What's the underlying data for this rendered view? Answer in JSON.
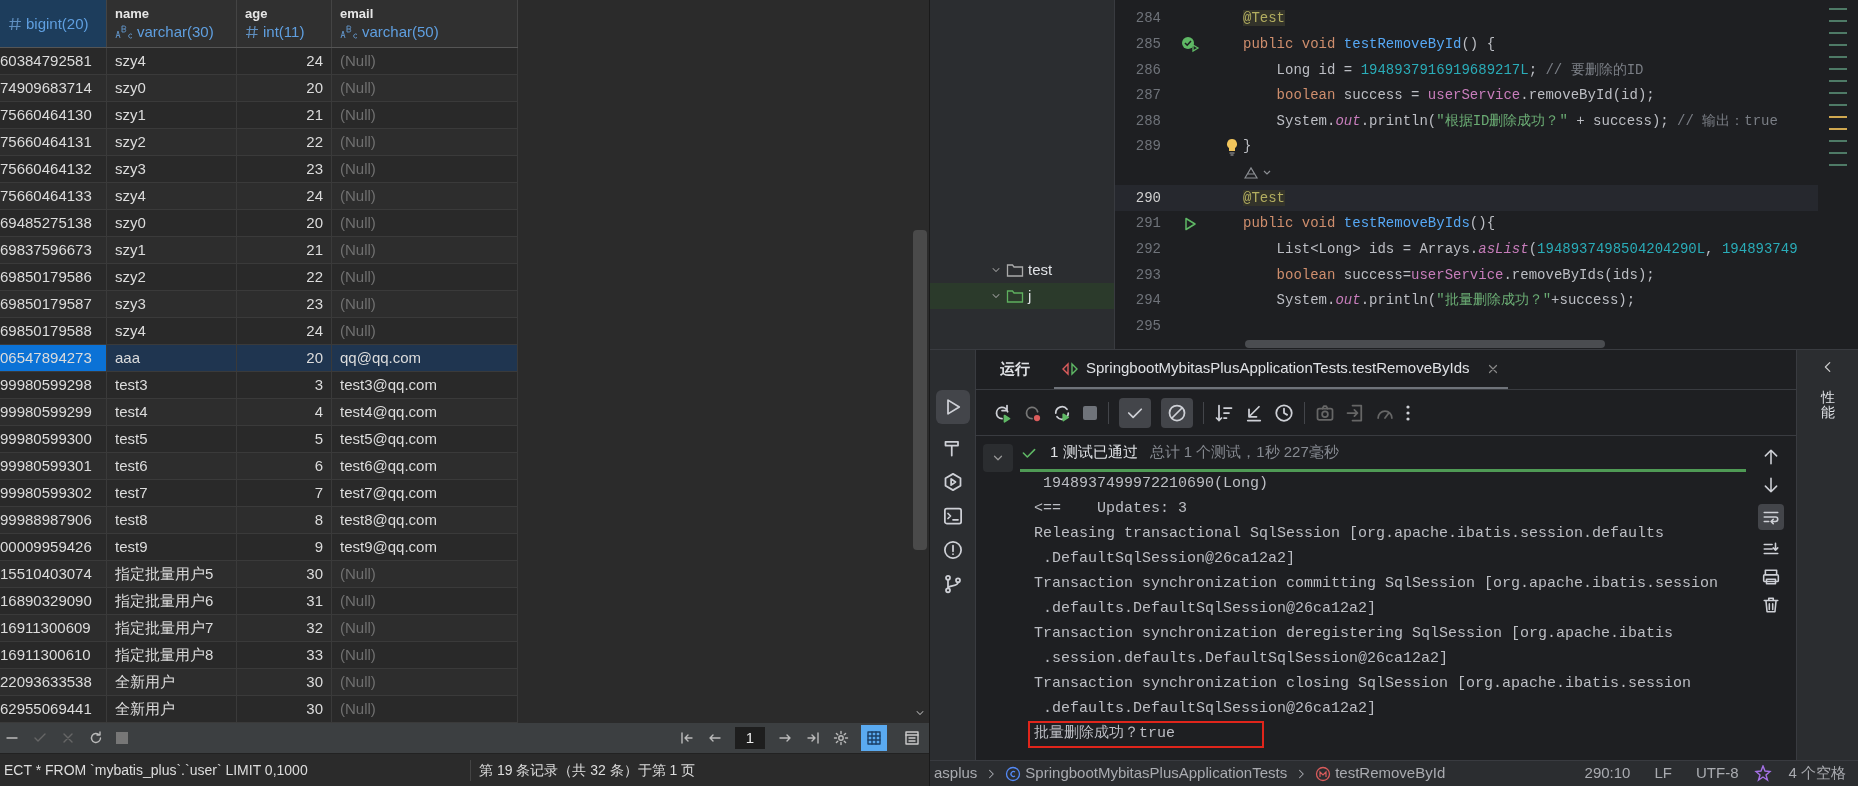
{
  "table": {
    "columns": [
      {
        "type": "bigint(20)",
        "kind": "number"
      },
      {
        "name": "name",
        "type": "varchar(30)",
        "kind": "text"
      },
      {
        "name": "age",
        "type": "int(11)",
        "kind": "number"
      },
      {
        "name": "email",
        "type": "varchar(50)",
        "kind": "text"
      }
    ],
    "rows": [
      {
        "cells": [
          "60384792581",
          "szy4",
          "24",
          "(Null)"
        ],
        "email_is_null": true,
        "selected": false
      },
      {
        "cells": [
          "74909683714",
          "szy0",
          "20",
          "(Null)"
        ],
        "email_is_null": true,
        "selected": false
      },
      {
        "cells": [
          "75660464130",
          "szy1",
          "21",
          "(Null)"
        ],
        "email_is_null": true,
        "selected": false
      },
      {
        "cells": [
          "75660464131",
          "szy2",
          "22",
          "(Null)"
        ],
        "email_is_null": true,
        "selected": false
      },
      {
        "cells": [
          "75660464132",
          "szy3",
          "23",
          "(Null)"
        ],
        "email_is_null": true,
        "selected": false
      },
      {
        "cells": [
          "75660464133",
          "szy4",
          "24",
          "(Null)"
        ],
        "email_is_null": true,
        "selected": false
      },
      {
        "cells": [
          "69485275138",
          "szy0",
          "20",
          "(Null)"
        ],
        "email_is_null": true,
        "selected": false
      },
      {
        "cells": [
          "69837596673",
          "szy1",
          "21",
          "(Null)"
        ],
        "email_is_null": true,
        "selected": false
      },
      {
        "cells": [
          "69850179586",
          "szy2",
          "22",
          "(Null)"
        ],
        "email_is_null": true,
        "selected": false
      },
      {
        "cells": [
          "69850179587",
          "szy3",
          "23",
          "(Null)"
        ],
        "email_is_null": true,
        "selected": false
      },
      {
        "cells": [
          "69850179588",
          "szy4",
          "24",
          "(Null)"
        ],
        "email_is_null": true,
        "selected": false
      },
      {
        "cells": [
          "06547894273",
          "aaa",
          "20",
          "qq@qq.com"
        ],
        "email_is_null": false,
        "selected": true
      },
      {
        "cells": [
          "99980599298",
          "test3",
          "3",
          "test3@qq.com"
        ],
        "email_is_null": false,
        "selected": false
      },
      {
        "cells": [
          "99980599299",
          "test4",
          "4",
          "test4@qq.com"
        ],
        "email_is_null": false,
        "selected": false
      },
      {
        "cells": [
          "99980599300",
          "test5",
          "5",
          "test5@qq.com"
        ],
        "email_is_null": false,
        "selected": false
      },
      {
        "cells": [
          "99980599301",
          "test6",
          "6",
          "test6@qq.com"
        ],
        "email_is_null": false,
        "selected": false
      },
      {
        "cells": [
          "99980599302",
          "test7",
          "7",
          "test7@qq.com"
        ],
        "email_is_null": false,
        "selected": false
      },
      {
        "cells": [
          "99988987906",
          "test8",
          "8",
          "test8@qq.com"
        ],
        "email_is_null": false,
        "selected": false
      },
      {
        "cells": [
          "00009959426",
          "test9",
          "9",
          "test9@qq.com"
        ],
        "email_is_null": false,
        "selected": false
      },
      {
        "cells": [
          "15510403074",
          "指定批量用户5",
          "30",
          "(Null)"
        ],
        "email_is_null": true,
        "selected": false
      },
      {
        "cells": [
          "16890329090",
          "指定批量用户6",
          "31",
          "(Null)"
        ],
        "email_is_null": true,
        "selected": false
      },
      {
        "cells": [
          "16911300609",
          "指定批量用户7",
          "32",
          "(Null)"
        ],
        "email_is_null": true,
        "selected": false
      },
      {
        "cells": [
          "16911300610",
          "指定批量用户8",
          "33",
          "(Null)"
        ],
        "email_is_null": true,
        "selected": false
      },
      {
        "cells": [
          "22093633538",
          "全新用户",
          "30",
          "(Null)"
        ],
        "email_is_null": true,
        "selected": false
      },
      {
        "cells": [
          "62955069441",
          "全新用户",
          "30",
          "(Null)"
        ],
        "email_is_null": true,
        "selected": false
      }
    ]
  },
  "grid_toolbar": {
    "page": "1",
    "views": [
      {
        "kind": "grid",
        "selected": true
      },
      {
        "kind": "form",
        "selected": false
      }
    ]
  },
  "grid_status": {
    "query": "ECT * FROM `mybatis_plus`.`user` LIMIT 0,1000",
    "records": "第 19 条记录（共 32 条）于第 1 页"
  },
  "project_tree": [
    {
      "label": "test",
      "kind": "folder"
    },
    {
      "label": "j",
      "kind": "source"
    }
  ],
  "editor": {
    "lines": [
      {
        "number": "284",
        "current": false,
        "kind": "code",
        "tokens": [
          {
            "kind": "annotation",
            "text": "@Test"
          }
        ]
      },
      {
        "number": "285",
        "current": false,
        "kind": "test_passed",
        "tokens": [
          {
            "kind": "keyword",
            "text": "public void "
          },
          {
            "kind": "method",
            "text": "testRemoveById"
          },
          {
            "kind": "plain",
            "text": "() {"
          }
        ]
      },
      {
        "number": "286",
        "current": false,
        "kind": "code",
        "tokens": [
          {
            "kind": "plain",
            "text": "    Long id = "
          },
          {
            "kind": "number",
            "text": "1948937916919689217L"
          },
          {
            "kind": "plain",
            "text": "; "
          },
          {
            "kind": "comment",
            "text": "// 要删除的ID"
          }
        ]
      },
      {
        "number": "287",
        "current": false,
        "kind": "code",
        "tokens": [
          {
            "kind": "keyword",
            "text": "    boolean "
          },
          {
            "kind": "plain",
            "text": "success = "
          },
          {
            "kind": "field",
            "text": "userService"
          },
          {
            "kind": "plain",
            "text": ".removeById(id);"
          }
        ]
      },
      {
        "number": "288",
        "current": false,
        "kind": "code",
        "tokens": [
          {
            "kind": "plain",
            "text": "    System."
          },
          {
            "kind": "static",
            "text": "out"
          },
          {
            "kind": "plain",
            "text": ".println("
          },
          {
            "kind": "string",
            "text": "\"根据ID删除成功？\""
          },
          {
            "kind": "plain",
            "text": " + success); "
          },
          {
            "kind": "comment",
            "text": "// 输出：true"
          }
        ]
      },
      {
        "number": "289",
        "current": false,
        "kind": "bulb",
        "tokens": [
          {
            "kind": "plain",
            "text": "}"
          }
        ]
      },
      {
        "current": false,
        "kind": "hint"
      },
      {
        "number": "290",
        "current": true,
        "kind": "code",
        "tokens": [
          {
            "kind": "annotation",
            "text": "@Test"
          }
        ]
      },
      {
        "number": "291",
        "current": false,
        "kind": "test",
        "tokens": [
          {
            "kind": "keyword",
            "text": "public void "
          },
          {
            "kind": "method",
            "text": "testRemoveByIds"
          },
          {
            "kind": "plain",
            "text": "(){"
          }
        ]
      },
      {
        "number": "292",
        "current": false,
        "kind": "code",
        "tokens": [
          {
            "kind": "plain",
            "text": "    List<Long> ids = Arrays."
          },
          {
            "kind": "static",
            "text": "asList"
          },
          {
            "kind": "plain",
            "text": "("
          },
          {
            "kind": "number",
            "text": "1948937498504204290L"
          },
          {
            "kind": "plain",
            "text": ", "
          },
          {
            "kind": "number",
            "text": "194893749"
          }
        ]
      },
      {
        "number": "293",
        "current": false,
        "kind": "code",
        "tokens": [
          {
            "kind": "keyword",
            "text": "    boolean "
          },
          {
            "kind": "plain",
            "text": "success="
          },
          {
            "kind": "field",
            "text": "userService"
          },
          {
            "kind": "plain",
            "text": ".removeByIds(ids);"
          }
        ]
      },
      {
        "number": "294",
        "current": false,
        "kind": "code",
        "tokens": [
          {
            "kind": "plain",
            "text": "    System."
          },
          {
            "kind": "static",
            "text": "out"
          },
          {
            "kind": "plain",
            "text": ".println("
          },
          {
            "kind": "string",
            "text": "\"批量删除成功？\""
          },
          {
            "kind": "plain",
            "text": "+success);"
          }
        ]
      },
      {
        "number": "295",
        "current": false,
        "kind": "code"
      }
    ]
  },
  "run_panel": {
    "title": "运行",
    "tab": "SpringbootMybitasPlusApplicationTests.testRemoveByIds",
    "toggles": [
      {
        "selected": true
      },
      {
        "selected": true
      }
    ],
    "result": {
      "passed": "1 测试已通过",
      "summary": "总计 1 个测试，1秒 227毫秒"
    },
    "console": [
      {
        "text": " 1948937499972210690(Long)",
        "boxed": false
      },
      {
        "text": "<==    Updates: 3",
        "boxed": false
      },
      {
        "text": "Releasing transactional SqlSession [org.apache.ibatis.session.defaults",
        "boxed": false
      },
      {
        "text": " .DefaultSqlSession@26ca12a2]",
        "boxed": false
      },
      {
        "text": "Transaction synchronization committing SqlSession [org.apache.ibatis.session",
        "boxed": false
      },
      {
        "text": " .defaults.DefaultSqlSession@26ca12a2]",
        "boxed": false
      },
      {
        "text": "Transaction synchronization deregistering SqlSession [org.apache.ibatis",
        "boxed": false
      },
      {
        "text": " .session.defaults.DefaultSqlSession@26ca12a2]",
        "boxed": false
      },
      {
        "text": "Transaction synchronization closing SqlSession [org.apache.ibatis.session",
        "boxed": false
      },
      {
        "text": " .defaults.DefaultSqlSession@26ca12a2]",
        "boxed": false
      },
      {
        "text": "批量删除成功？true",
        "boxed": true
      }
    ],
    "side_panel": "性能"
  },
  "status_bar": {
    "breadcrumbs": [
      "asplus",
      "SpringbootMybitasPlusApplicationTests",
      "testRemoveById"
    ],
    "position": "290:10",
    "line_ending": "LF",
    "encoding": "UTF-8",
    "indent": "4 个空格"
  }
}
